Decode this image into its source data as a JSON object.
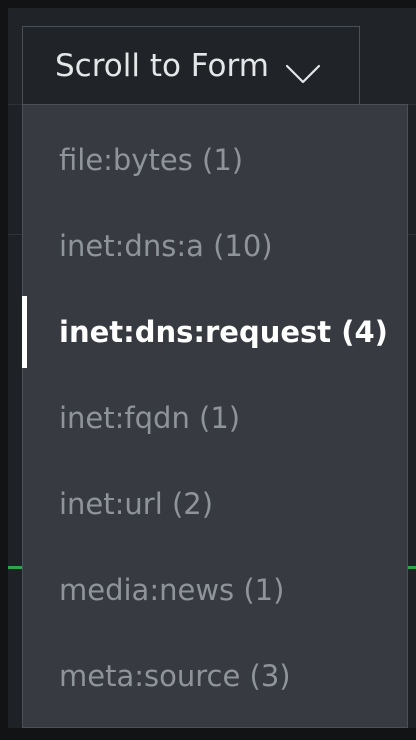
{
  "scroll_button": {
    "label": "Scroll to Form",
    "icon": "chevron-down-icon"
  },
  "menu": {
    "items": [
      {
        "label": "file:bytes (1)",
        "active": false
      },
      {
        "label": "inet:dns:a (10)",
        "active": false
      },
      {
        "label": "inet:dns:request (4)",
        "active": true
      },
      {
        "label": "inet:fqdn (1)",
        "active": false
      },
      {
        "label": "inet:url (2)",
        "active": false
      },
      {
        "label": "media:news (1)",
        "active": false
      },
      {
        "label": "meta:source (3)",
        "active": false
      }
    ]
  },
  "colors": {
    "menu_bg": "#373b41",
    "text_muted": "#8e949a",
    "text_active": "#ffffff",
    "accent_line": "#2ea44f"
  }
}
